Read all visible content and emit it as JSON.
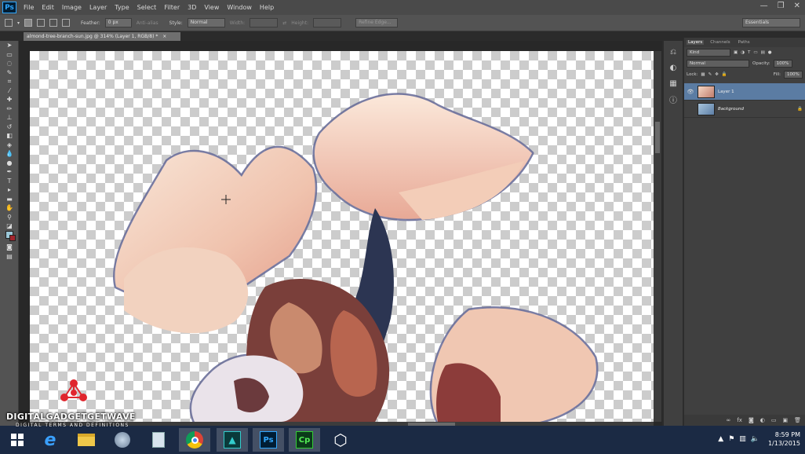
{
  "app": {
    "logo_text": "Ps"
  },
  "menu": [
    "File",
    "Edit",
    "Image",
    "Layer",
    "Type",
    "Select",
    "Filter",
    "3D",
    "View",
    "Window",
    "Help"
  ],
  "window_controls": {
    "minimize": "—",
    "restore": "❐",
    "close": "✕"
  },
  "options_bar": {
    "feather_label": "Feather:",
    "feather_value": "0 px",
    "antialias_label": "Anti-alias",
    "style_label": "Style:",
    "style_value": "Normal",
    "width_label": "Width:",
    "height_label": "Height:",
    "refine_edge_label": "Refine Edge...",
    "workspace_value": "Essentials"
  },
  "document_tab": {
    "title": "almond-tree-branch-sun.jpg @ 314% (Layer 1, RGB/8) *",
    "close": "×"
  },
  "layers_panel": {
    "tabs": [
      "Layers",
      "Channels",
      "Paths"
    ],
    "kind_label": "Kind",
    "blend_mode": "Normal",
    "opacity_label": "Opacity:",
    "opacity_value": "100%",
    "lock_label": "Lock:",
    "fill_label": "Fill:",
    "fill_value": "100%",
    "layers": [
      {
        "name": "Layer 1",
        "selected": true
      },
      {
        "name": "Background",
        "selected": false
      }
    ]
  },
  "taskbar": {
    "time": "8:59 PM",
    "date": "1/13/2015",
    "apps": [
      "windows",
      "ie",
      "explorer",
      "media",
      "chrome",
      "dreamweaver",
      "photoshop",
      "captivate",
      "unity"
    ],
    "ps_label": "Ps",
    "cp_label": "Cp"
  },
  "watermark": {
    "brand": "DIGITALGADGETGETWAVE",
    "tagline": "DIGITAL TERMS AND DEFINITIONS",
    "accent": "#e0262e"
  }
}
